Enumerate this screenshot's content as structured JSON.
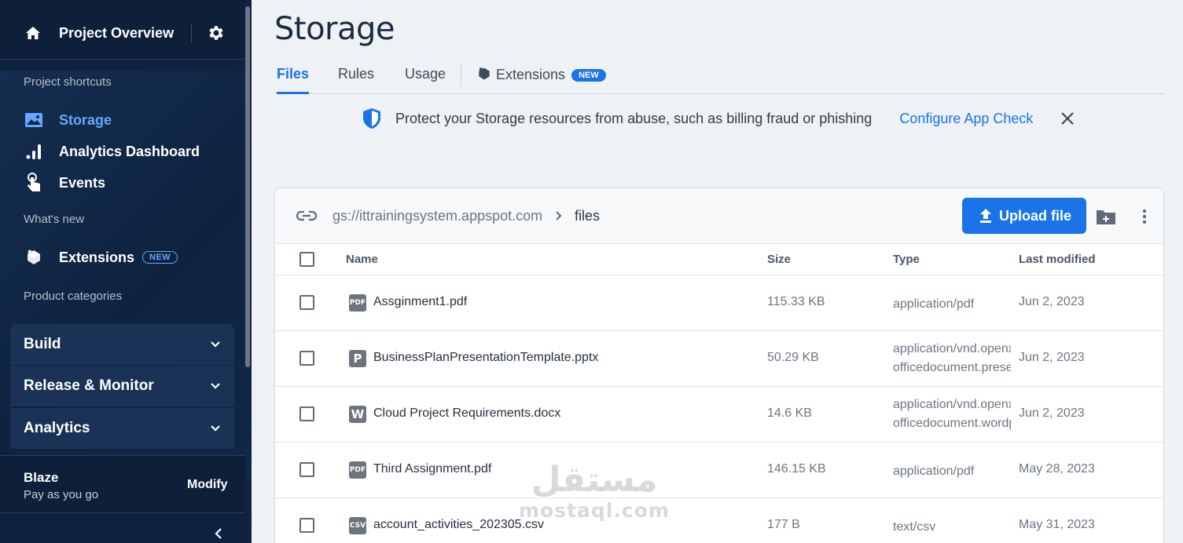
{
  "colors": {
    "sidebar_bg": "#0f2340",
    "accent": "#1a73e8",
    "active_sidebar": "#62a8ff"
  },
  "sidebar": {
    "project_title": "Project Overview",
    "sections": {
      "shortcuts": "Project shortcuts",
      "whats_new": "What's new",
      "categories": "Product categories"
    },
    "items": [
      {
        "label": "Storage",
        "icon": "image-icon",
        "active": true
      },
      {
        "label": "Analytics Dashboard",
        "icon": "bar-chart-icon"
      },
      {
        "label": "Events",
        "icon": "touch-icon"
      }
    ],
    "extensions": {
      "label": "Extensions",
      "badge": "NEW",
      "icon": "puzzle-icon"
    },
    "categories": [
      "Build",
      "Release & Monitor",
      "Analytics"
    ],
    "plan": {
      "name": "Blaze",
      "description": "Pay as you go",
      "modify": "Modify"
    }
  },
  "page": {
    "title": "Storage"
  },
  "tabs": [
    {
      "label": "Files",
      "active": true
    },
    {
      "label": "Rules"
    },
    {
      "label": "Usage"
    },
    {
      "label": "Extensions",
      "badge": "NEW"
    }
  ],
  "banner": {
    "message": "Protect your Storage resources from abuse, such as billing fraud or phishing",
    "cta": "Configure App Check"
  },
  "browser": {
    "bucket": "gs://ittrainingsystem.appspot.com",
    "folder": "files",
    "upload_label": "Upload file",
    "columns": {
      "name": "Name",
      "size": "Size",
      "type": "Type",
      "modified": "Last modified"
    },
    "rows": [
      {
        "icon": "PDF",
        "name": "Assginment1.pdf",
        "size": "115.33 KB",
        "type1": "application/pdf",
        "type2": "",
        "date": "Jun 2, 2023"
      },
      {
        "icon": "P",
        "name": "BusinessPlanPresentationTemplate.pptx",
        "size": "50.29 KB",
        "type1": "application/vnd.openxmlformats-",
        "type2": "officedocument.presentationml.presentation",
        "date": "Jun 2, 2023"
      },
      {
        "icon": "W",
        "name": "Cloud Project Requirements.docx",
        "size": "14.6 KB",
        "type1": "application/vnd.openxmlformats-",
        "type2": "officedocument.wordprocessingml.document",
        "date": "Jun 2, 2023"
      },
      {
        "icon": "PDF",
        "name": "Third Assignment.pdf",
        "size": "146.15 KB",
        "type1": "application/pdf",
        "type2": "",
        "date": "May 28, 2023"
      },
      {
        "icon": "CSV",
        "name": "account_activities_202305.csv",
        "size": "177 B",
        "type1": "text/csv",
        "type2": "",
        "date": "May 31, 2023"
      }
    ]
  },
  "watermark": {
    "arabic": "مستقل",
    "latin": "mostaql.com"
  }
}
